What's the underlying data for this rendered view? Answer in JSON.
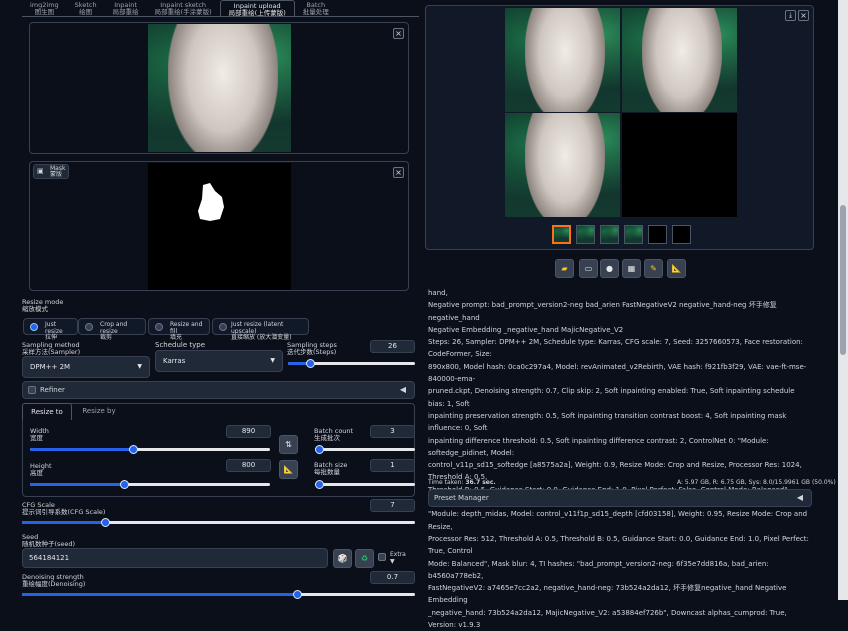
{
  "tabs": [
    {
      "en": "img2img",
      "zh": "图生图"
    },
    {
      "en": "Sketch",
      "zh": "绘图"
    },
    {
      "en": "Inpaint",
      "zh": "局部重绘"
    },
    {
      "en": "Inpaint sketch",
      "zh": "局部重绘(手涂蒙版)"
    },
    {
      "en": "Inpaint upload",
      "zh": "局部重绘(上传蒙版)"
    },
    {
      "en": "Batch",
      "zh": "批量处理"
    }
  ],
  "mask": {
    "en": "Mask",
    "zh": "蒙版"
  },
  "resize_mode": {
    "label_en": "Resize mode",
    "label_zh": "缩放模式",
    "options": [
      {
        "en": "Just resize",
        "zh": "拉伸"
      },
      {
        "en": "Crop and resize",
        "zh": "裁剪"
      },
      {
        "en": "Resize and fill",
        "zh": "填充"
      },
      {
        "en": "Just resize (latent upscale)",
        "zh": "直接缩放 (放大潜变量)"
      }
    ],
    "selected_index": 0
  },
  "sampling_method": {
    "label_en": "Sampling method",
    "label_zh": "采样方法(Sampler)",
    "value": "DPM++ 2M"
  },
  "schedule_type": {
    "label": "Schedule type",
    "value": "Karras"
  },
  "sampling_steps": {
    "label_en": "Sampling steps",
    "label_zh": "迭代步数(Steps)",
    "value": "26",
    "fraction": 0.17
  },
  "refiner": {
    "label": "Refiner",
    "arrow": "◀"
  },
  "size_tabs": {
    "resize_to": "Resize to",
    "resize_by": "Resize by"
  },
  "width": {
    "label_en": "Width",
    "label_zh": "宽度",
    "value": "890",
    "fraction": 0.43
  },
  "height": {
    "label_en": "Height",
    "label_zh": "高度",
    "value": "800",
    "fraction": 0.39
  },
  "batch_count": {
    "label_en": "Batch count",
    "label_zh": "生成批次",
    "value": "3",
    "fraction": 0.02
  },
  "batch_size": {
    "label_en": "Batch size",
    "label_zh": "每批数量",
    "value": "1",
    "fraction": 0.0
  },
  "cfg": {
    "label_en": "CFG Scale",
    "label_zh": "提示词引导系数(CFG Scale)",
    "value": "7",
    "fraction": 0.21
  },
  "seed": {
    "label_en": "Seed",
    "label_zh": "随机数种子(seed)",
    "value": "564184121",
    "extra": "Extra"
  },
  "denoise": {
    "label_en": "Denoising strength",
    "label_zh": "重绘幅度(Denoising)",
    "value": "0.7",
    "fraction": 0.7
  },
  "generation_info": {
    "prompt": "hand,",
    "lines": [
      "Negative prompt: bad_prompt_version2-neg bad_arien FastNegativeV2 negative_hand-neg 坏手修复negative_hand",
      "Negative Embedding _negative_hand MajicNegative_V2",
      "Steps: 26, Sampler: DPM++ 2M, Schedule type: Karras, CFG scale: 7, Seed: 3257660573, Face restoration: CodeFormer, Size:",
      "890x800, Model hash: 0ca0c297a4, Model: revAnimated_v2Rebirth, VAE hash: f921fb3f29, VAE: vae-ft-mse-840000-ema-",
      "pruned.ckpt, Denoising strength: 0.7, Clip skip: 2, Soft inpainting enabled: True, Soft inpainting schedule bias: 1, Soft",
      "inpainting preservation strength: 0.5, Soft inpainting transition contrast boost: 4, Soft inpainting mask influence: 0, Soft",
      "inpainting difference threshold: 0.5, Soft inpainting difference contrast: 2, ControlNet 0: \"Module: softedge_pidinet, Model:",
      "control_v11p_sd15_softedge [a8575a2a], Weight: 0.9, Resize Mode: Crop and Resize, Processor Res: 1024, Threshold A: 0.5,",
      "Threshold B: 0.5, Guidance Start: 0.0, Guidance End: 1.0, Pixel Perfect: False, Control Mode: Balanced\", ControlNet 1:",
      "\"Module: depth_midas, Model: control_v11f1p_sd15_depth [cfd03158], Weight: 0.95, Resize Mode: Crop and Resize,",
      "Processor Res: 512, Threshold A: 0.5, Threshold B: 0.5, Guidance Start: 0.0, Guidance End: 1.0, Pixel Perfect: True, Control",
      "Mode: Balanced\", Mask blur: 4, TI hashes: \"bad_prompt_version2-neg: 6f35e7dd816a, bad_arien: b4560a778eb2,",
      "FastNegativeV2: a7465e7cc2a2, negative_hand-neg: 73b524a2da12, 坏手修复negative_hand Negative Embedding",
      "_negative_hand: 73b524a2da12, MajicNegative_V2: a53884ef726b\", Downcast alphas_cumprod: True, Version: v1.9.3"
    ]
  },
  "time_taken": {
    "label": "Time taken:",
    "value": "36.7 sec."
  },
  "vram": {
    "a": "A: 5.97 GB",
    "r": "R: 6.75 GB",
    "sys": "Sys: 8.0/15.9961 GB (50.0%)"
  },
  "preset_manager": {
    "label": "Preset Manager",
    "arrow": "◀"
  },
  "colors": {
    "accent": "#2563eb",
    "bg": "#0b0f19",
    "panel": "#1f2937",
    "thumb_selected": "#f97316"
  },
  "icons": [
    "close-icon",
    "download-icon",
    "folder-icon",
    "chat-icon",
    "palette-icon",
    "grid-icon",
    "brush-icon",
    "ruler-icon",
    "dice-icon",
    "recycle-icon",
    "swap-icon"
  ]
}
